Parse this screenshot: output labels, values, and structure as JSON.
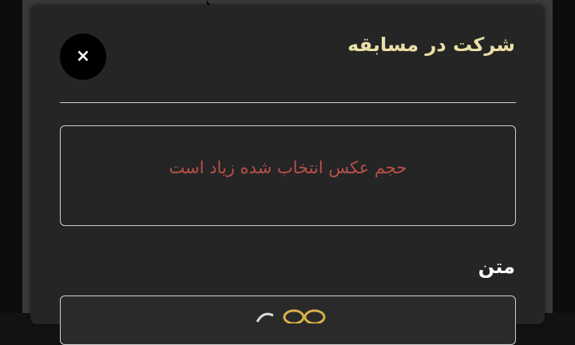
{
  "modal": {
    "title": "شرکت در مسابقه",
    "close_label": "×",
    "error_message": "حجم عکس انتخاب شده زیاد است",
    "text_field_label": "متن"
  },
  "colors": {
    "title": "#e9dfa8",
    "error": "#b9504a",
    "modal_background": "#252525",
    "close_button_background": "#000000"
  },
  "icons": {
    "close": "close-icon"
  }
}
